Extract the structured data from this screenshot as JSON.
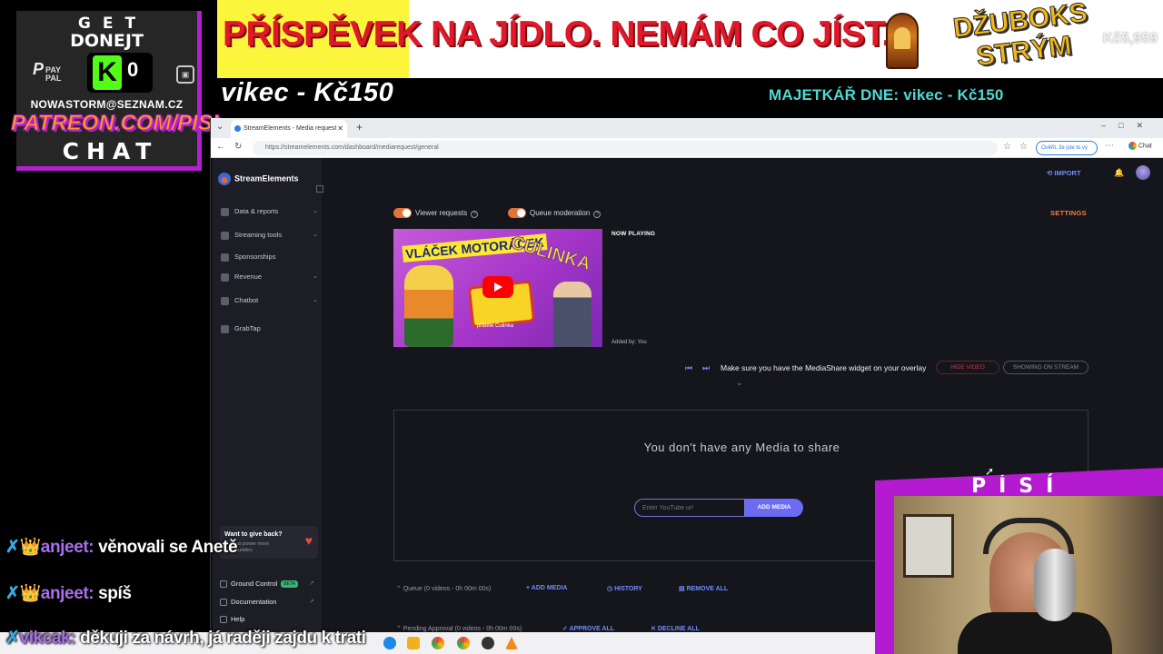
{
  "overlay": {
    "donate": {
      "line1": "GET",
      "line2": "DONEJT",
      "paypal_p": "P",
      "paypal_text": "PAY PAL",
      "kick_letter": "K",
      "kick_count": "0",
      "email": "NOWASTORM@SEZNAM.CZ",
      "patreon": "PATREON.COM/PISI",
      "chat_label": "CHAT"
    },
    "banner": {
      "text": "PŘÍSPĚVEK NA JÍDLO. NEMÁM CO JÍST.",
      "jukebox_text": "DŽUBOKS STRÝM",
      "goal": "Kč5,959"
    },
    "last_donation": "vikec - Kč150",
    "top_donor": "MAJETKÁŘ DNE: vikec - Kč150",
    "chat": [
      {
        "badges": "✗",
        "crown": "👑",
        "user": "anjeet:",
        "text": "věnovali se Anetě"
      },
      {
        "badges": "✗",
        "crown": "👑",
        "user": "anjeet:",
        "text": "spíš"
      },
      {
        "badges": "✗",
        "crown": "",
        "user": "vikcak:",
        "text": "děkuji za návrh, já raději zajdu k trati"
      }
    ],
    "webcam_label": "PÍSÍ"
  },
  "browser": {
    "tab_title": "StreamElements - Media request",
    "url": "https://streamelements.com/dashboard/mediarequest/general",
    "verify_label": "Ověřit, že jste to vy",
    "chat_label": "Chat"
  },
  "sidebar": {
    "brand": "StreamElements",
    "items": [
      {
        "label": "Data & reports",
        "chevron": "⌄"
      },
      {
        "label": "Streaming tools",
        "chevron": "⌄"
      },
      {
        "label": "Sponsorships",
        "chevron": ""
      },
      {
        "label": "Revenue",
        "chevron": "⌄"
      },
      {
        "label": "Chatbot",
        "chevron": "⌄"
      },
      {
        "label": "GrabTap",
        "chevron": ""
      }
    ],
    "giveback": {
      "title": "Want to give back?",
      "subtitle": "Help us power more communities"
    },
    "bottom": [
      {
        "label": "Ground Control",
        "badge": "BETA"
      },
      {
        "label": "Documentation",
        "badge": ""
      },
      {
        "label": "Help",
        "badge": ""
      }
    ]
  },
  "topbar": {
    "import": "IMPORT"
  },
  "media": {
    "viewer_requests": "Viewer requests",
    "queue_moderation": "Queue moderation",
    "settings": "SETTINGS",
    "thumb_title1": "VLÁČEK MOTORÁČEK",
    "thumb_title2": "CULINKA",
    "thumb_caption": "přátelé Culinka",
    "now_playing": "NOW PLAYING",
    "added_by": "Added by: You",
    "widget_msg": "Make sure you have the MediaShare widget on your overlay",
    "hide_video": "HIDE VIDEO",
    "showing_on_stream": "SHOWING ON STREAM",
    "empty_msg": "You don't have any Media to share",
    "input_placeholder": "Enter YouTube url",
    "add_media_btn": "ADD MEDIA",
    "queue_label": "Queue (0 videos - 0h 00m 00s)",
    "queue_add": "ADD MEDIA",
    "history": "HISTORY",
    "remove_all": "REMOVE ALL",
    "pending_label": "Pending Approval (0 videos - 0h 00m 00s)",
    "approve_all": "APPROVE ALL",
    "decline_all": "DECLINE ALL"
  },
  "colors": {
    "accent_orange": "#e4733a",
    "accent_blue": "#6b6bf3",
    "overlay_purple": "#b41ad0",
    "banner_red": "#e0182a"
  }
}
